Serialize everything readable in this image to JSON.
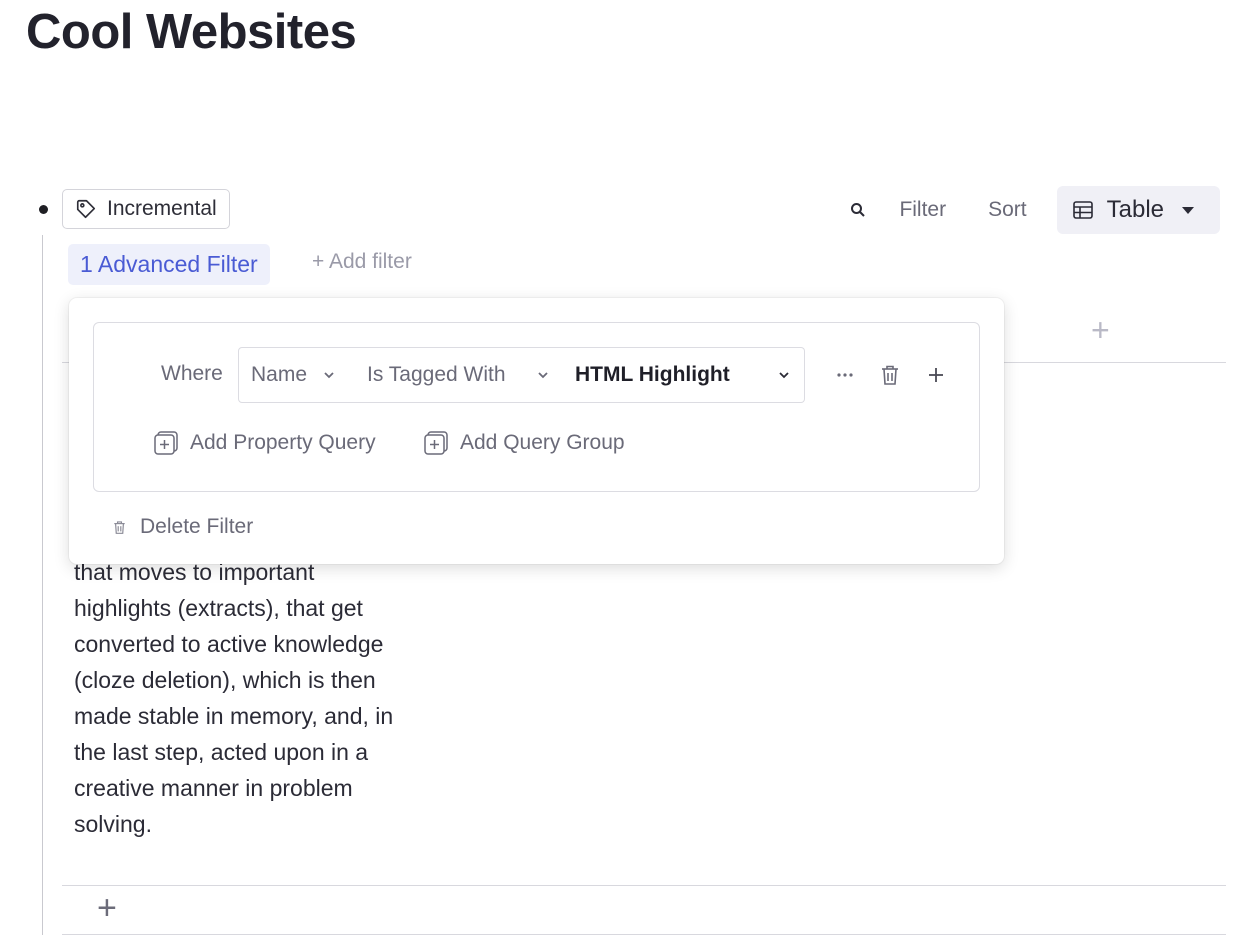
{
  "page": {
    "title": "Cool Websites"
  },
  "block": {
    "tag_label": "Incremental"
  },
  "toolbar": {
    "search_icon": "search-icon",
    "filter_label": "Filter",
    "sort_label": "Sort",
    "view_label": "Table",
    "view_icon": "table-icon"
  },
  "filters": {
    "advanced_label": "1 Advanced Filter",
    "add_label": "+ Add filter"
  },
  "popover": {
    "where_label": "Where",
    "property": "Name",
    "operator": "Is Tagged With",
    "value": "HTML Highlight",
    "add_property_query": "Add Property Query",
    "add_query_group": "Add Query Group",
    "delete_filter": "Delete Filter"
  },
  "table": {
    "add_column": "+",
    "add_row": "+",
    "cell_text": "that moves to important highlights (extracts), that get converted to active knowledge (cloze deletion), which is then made stable in memory, and, in the last step, acted upon in a creative manner in problem solving."
  },
  "colors": {
    "accent": "#4a5bd4",
    "accent_bg": "#eef0fb",
    "muted": "#6a6a78"
  }
}
